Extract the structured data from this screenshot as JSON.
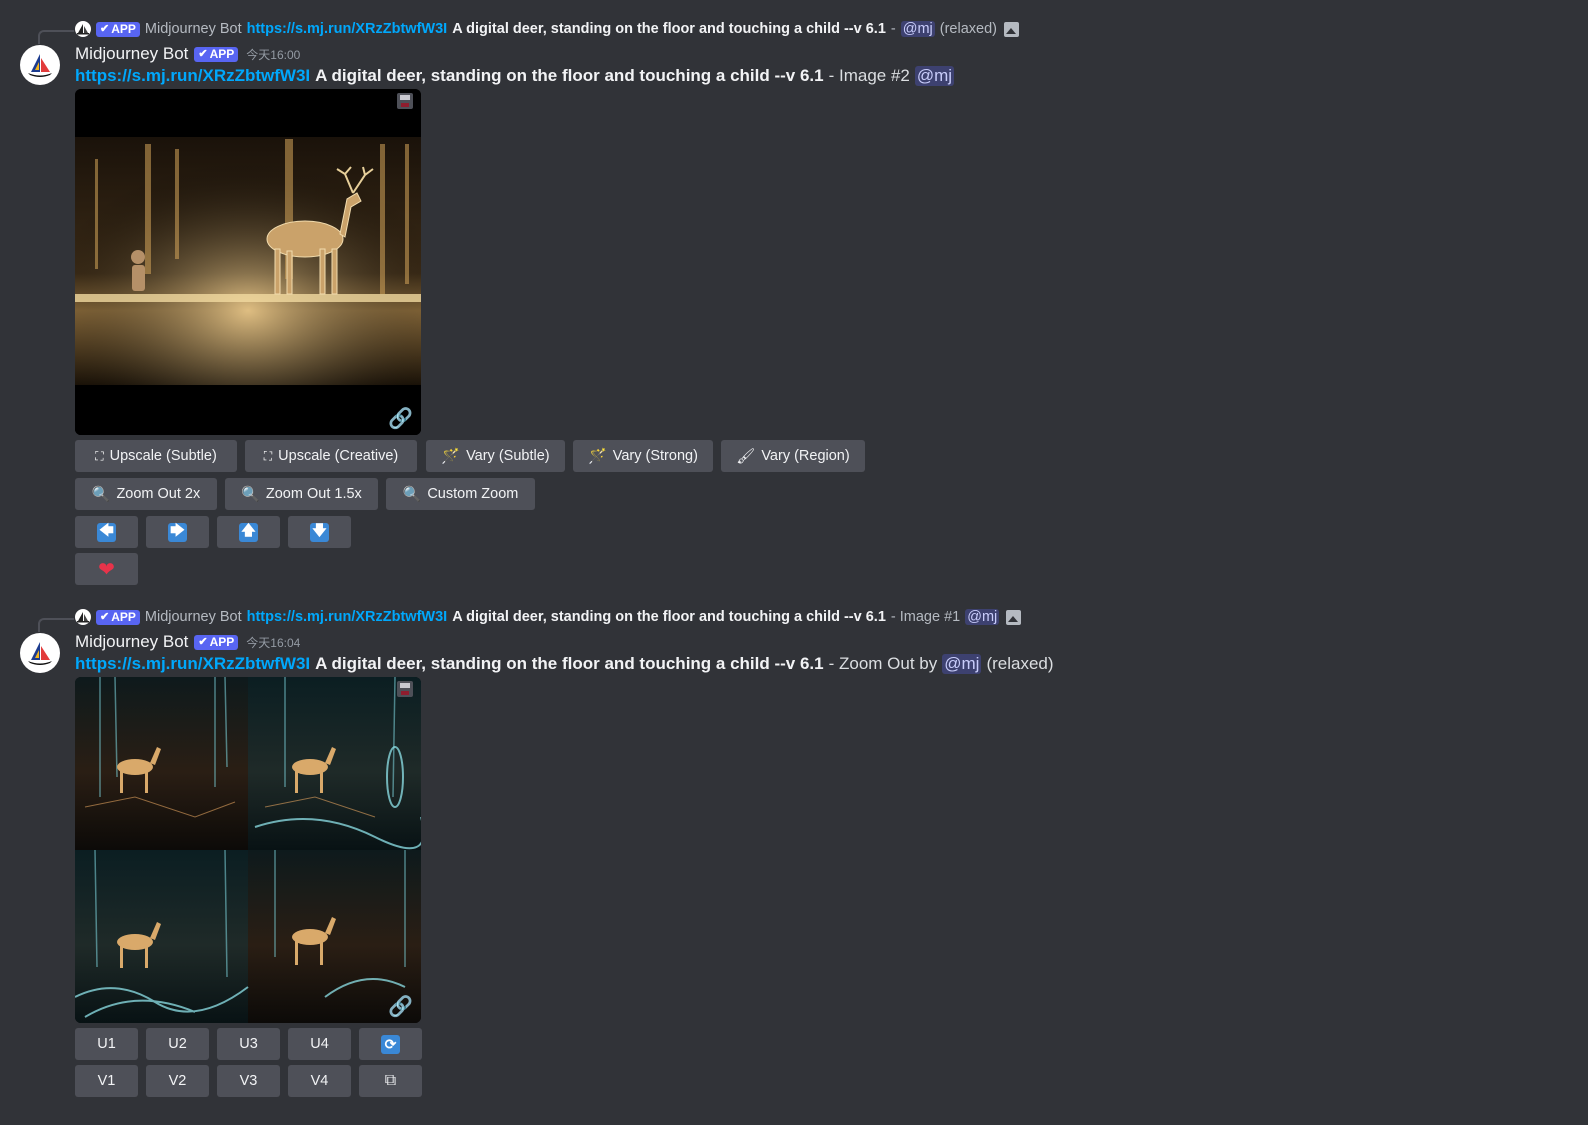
{
  "colors": {
    "background": "#313338",
    "button": "#4e5058",
    "link": "#00a8fc",
    "app_tag": "#5865f2",
    "heart": "#e8334a",
    "arrow": "#3a88d6"
  },
  "messages": [
    {
      "reply": {
        "app_label": "APP",
        "bot_name": "Midjourney Bot",
        "link": "https://s.mj.run/XRzZbtwfW3I",
        "prompt": "A digital deer, standing on the floor and touching a child --v 6.1",
        "sep": "-",
        "mention": "@mj",
        "suffix": "(relaxed)",
        "icon": "image-icon"
      },
      "username": "Midjourney Bot",
      "app_label": "APP",
      "timestamp": "今天16:00",
      "link": "https://s.mj.run/XRzZbtwfW3I",
      "prompt": "A digital deer, standing on the floor and touching a child --v 6.1",
      "tail": "- Image #2",
      "mention": "@mj",
      "buttons_row1": [
        "Upscale (Subtle)",
        "Upscale (Creative)",
        "Vary (Subtle)",
        "Vary (Strong)",
        "Vary (Region)"
      ],
      "buttons_row2": [
        "Zoom Out 2x",
        "Zoom Out 1.5x",
        "Custom Zoom"
      ],
      "arrows": [
        "arrow-left-icon",
        "arrow-right-icon",
        "arrow-up-icon",
        "arrow-down-icon"
      ],
      "arrow_glyphs": [
        "🡄",
        "🡆",
        "🡅",
        "🡇"
      ],
      "heart": "heart-icon"
    },
    {
      "reply": {
        "app_label": "APP",
        "bot_name": "Midjourney Bot",
        "link": "https://s.mj.run/XRzZbtwfW3I",
        "prompt": "A digital deer, standing on the floor and touching a child --v 6.1",
        "sep": "- Image #1",
        "mention": "@mj",
        "icon": "image-icon"
      },
      "username": "Midjourney Bot",
      "app_label": "APP",
      "timestamp": "今天16:04",
      "link": "https://s.mj.run/XRzZbtwfW3I",
      "prompt": "A digital deer, standing on the floor and touching a child --v 6.1",
      "tail": "- Zoom Out by",
      "mention": "@mj",
      "suffix": "(relaxed)",
      "u_buttons": [
        "U1",
        "U2",
        "U3",
        "U4"
      ],
      "v_buttons": [
        "V1",
        "V2",
        "V3",
        "V4"
      ],
      "reroll": "reroll-icon",
      "open": "open-external-icon"
    }
  ]
}
